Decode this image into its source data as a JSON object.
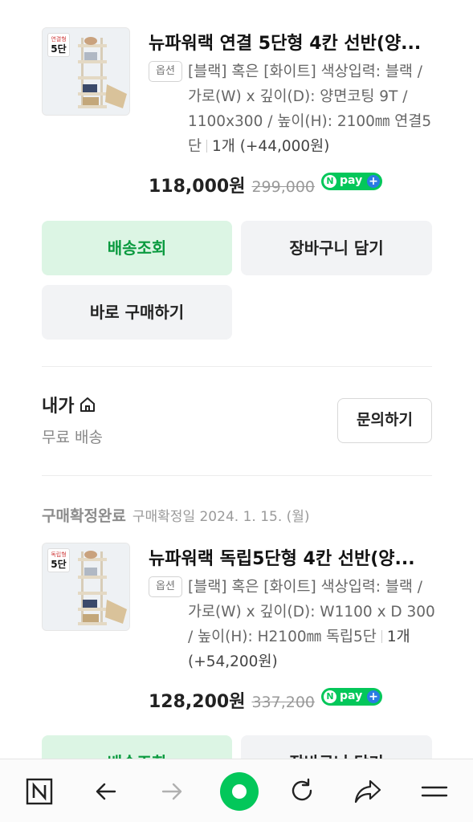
{
  "orders": [
    {
      "product": {
        "thumb_badge_small": "연결형",
        "thumb_badge_big": "5단",
        "title": "뉴파워랙 연결 5단형 4칸 선반(양...",
        "option_tag": "옵션",
        "option_text": "[블랙] 혹은 [화이트] 색상입력: 블랙 / 가로(W) x 깊이(D): 양면코팅 9T / 1100x300 / 높이(H): 2100㎜ 연결5단",
        "quantity": "1개 (+44,000원)",
        "price": "118,000원",
        "original_price": "299,000",
        "npay": "pay"
      },
      "buttons": {
        "track": "배송조회",
        "cart": "장바구니 담기",
        "buy_now": "바로 구매하기"
      }
    },
    {
      "status": "구매확정완료",
      "date": "구매확정일 2024. 1. 15. (월)",
      "product": {
        "thumb_badge_small": "독립형",
        "thumb_badge_big": "5단",
        "title": "뉴파워랙 독립5단형 4칸 선반(양...",
        "option_tag": "옵션",
        "option_text": "[블랙] 혹은 [화이트] 색상입력: 블랙 / 가로(W) x 깊이(D): W1100 x D 300 / 높이(H): H2100㎜ 독립5단",
        "quantity": "1개 (+54,200원)",
        "price": "128,200원",
        "original_price": "337,200",
        "npay": "pay"
      },
      "buttons": {
        "track": "배송조회",
        "cart": "장바구니 담기"
      }
    }
  ],
  "seller": {
    "name": "내가",
    "shipping": "무료 배송",
    "inquiry": "문의하기"
  },
  "toolbar": {
    "items": [
      "naver-home-icon",
      "back-icon",
      "forward-icon",
      "green-dot-icon",
      "refresh-icon",
      "share-icon",
      "menu-icon"
    ],
    "accent": "#03c75a"
  }
}
